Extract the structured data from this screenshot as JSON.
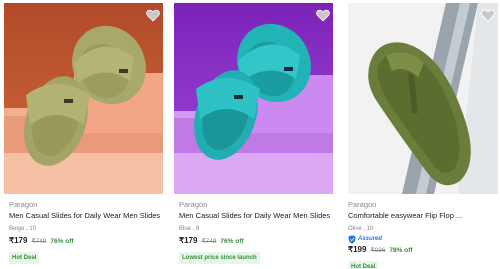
{
  "products": [
    {
      "brand": "Paragon",
      "title": "Men Casual Slides for Daily Wear Men Slides",
      "variant": "Beige , 10",
      "price": "₹179",
      "mrp": "₹749",
      "discount": "76% off",
      "tag": "Hot Deal",
      "image": {
        "background": "#c05a32",
        "product_color": "#a8a86a"
      },
      "wishlist_icon": "heart-icon"
    },
    {
      "brand": "Paragon",
      "title": "Men Casual Slides for Daily Wear Men Slides",
      "variant": "Blue , 8",
      "price": "₹179",
      "mrp": "₹749",
      "discount": "76% off",
      "tag": "Lowest price since launch",
      "image": {
        "background": "#8a2ec6",
        "product_color": "#22b3b6"
      },
      "wishlist_icon": "heart-icon"
    },
    {
      "brand": "Paragon",
      "title": "Comfortable easywear Flip Flop ...",
      "variant": "Olive , 10",
      "assured": "Assured",
      "price": "₹199",
      "mrp": "₹936",
      "discount": "78% off",
      "tag": "Hot Deal",
      "image": {
        "background": "#f2f2f2",
        "product_color": "#6b7d3a"
      },
      "wishlist_icon": "heart-icon"
    }
  ],
  "colors": {
    "discount_green": "#388e3c",
    "assured_blue": "#2874f0",
    "muted_text": "#878787"
  }
}
